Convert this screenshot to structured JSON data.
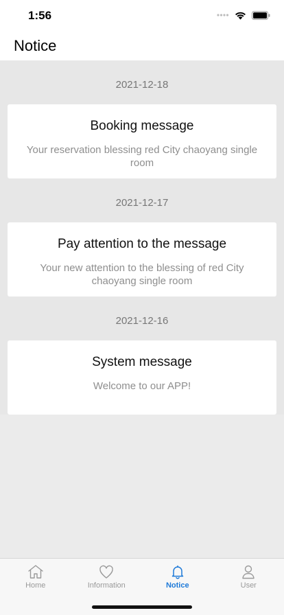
{
  "status_bar": {
    "time": "1:56"
  },
  "header": {
    "title": "Notice"
  },
  "notices": [
    {
      "date": "2021-12-18",
      "title": "Booking message",
      "body": "Your reservation blessing red City chaoyang single room"
    },
    {
      "date": "2021-12-17",
      "title": "Pay attention to the message",
      "body": "Your new attention to the blessing of red City chaoyang single room"
    },
    {
      "date": "2021-12-16",
      "title": "System message",
      "body": "Welcome to our APP!"
    }
  ],
  "tabs": [
    {
      "label": "Home",
      "icon": "home-icon",
      "active": false
    },
    {
      "label": "Information",
      "icon": "heart-icon",
      "active": false
    },
    {
      "label": "Notice",
      "icon": "bell-icon",
      "active": true
    },
    {
      "label": "User",
      "icon": "user-icon",
      "active": false
    }
  ],
  "colors": {
    "accent": "#1e7ad8",
    "inactive": "#999999",
    "background": "#e7e7e7"
  }
}
